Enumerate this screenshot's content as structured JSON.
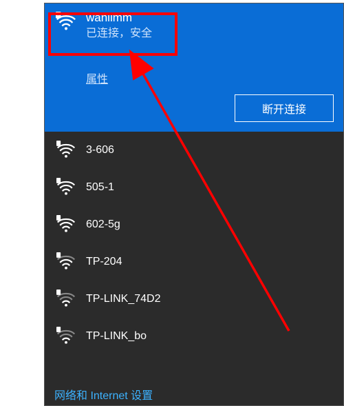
{
  "connected": {
    "name": "wanlimm",
    "status": "已连接，安全",
    "properties_label": "属性",
    "disconnect_label": "断开连接"
  },
  "networks": [
    {
      "name": "3-606"
    },
    {
      "name": "505-1"
    },
    {
      "name": "602-5g"
    },
    {
      "name": "TP-204"
    },
    {
      "name": "TP-LINK_74D2"
    },
    {
      "name": "TP-LINK_bo"
    }
  ],
  "settings_link": "网络和 Internet 设置"
}
